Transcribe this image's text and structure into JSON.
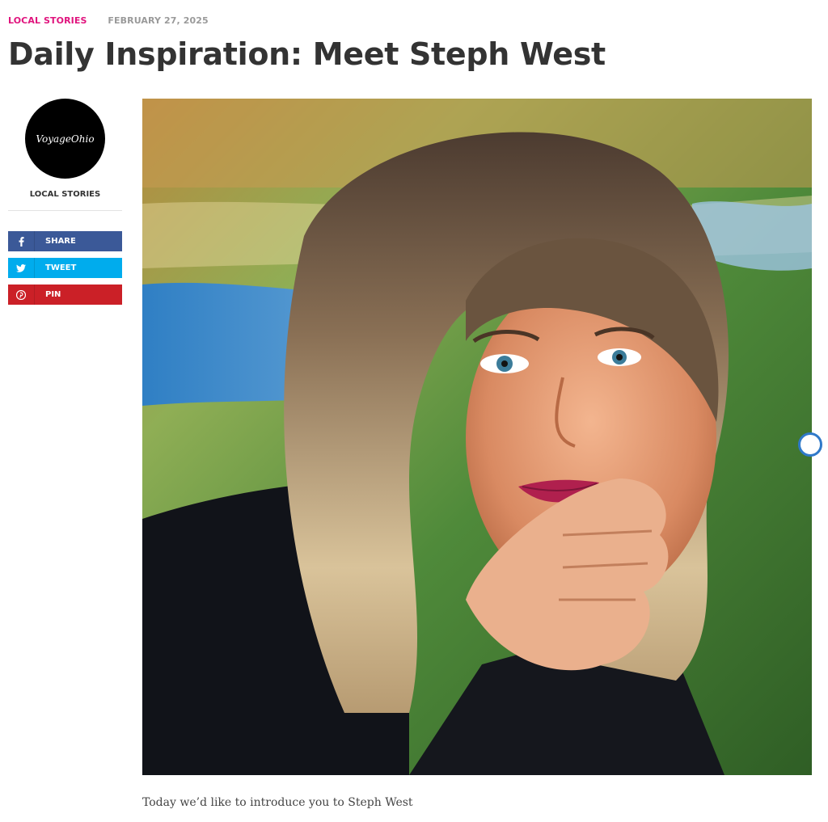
{
  "header": {
    "category": "LOCAL STORIES",
    "date": "FEBRUARY 27, 2025",
    "title": "Daily Inspiration: Meet Steph West"
  },
  "sidebar": {
    "avatar_text": "VoyageOhio",
    "author_label": "LOCAL STORIES",
    "share_buttons": [
      {
        "label": "SHARE",
        "icon": "facebook-icon",
        "color": "#3b5998"
      },
      {
        "label": "TWEET",
        "icon": "twitter-icon",
        "color": "#00aced"
      },
      {
        "label": "PIN",
        "icon": "pinterest-icon",
        "color": "#cb2027"
      }
    ]
  },
  "article": {
    "intro": "Today we’d like to introduce you to Steph West"
  },
  "colors": {
    "accent": "#e0137d",
    "date_gray": "#9a9a9a",
    "title": "#333333"
  }
}
